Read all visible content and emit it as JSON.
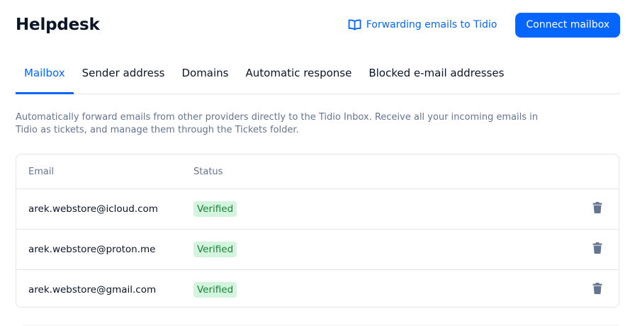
{
  "header": {
    "title": "Helpdesk",
    "doc_link_label": "Forwarding emails to Tidio",
    "doc_link_icon": "book-open-icon",
    "connect_button_label": "Connect mailbox"
  },
  "tabs": [
    {
      "label": "Mailbox",
      "active": true
    },
    {
      "label": "Sender address",
      "active": false
    },
    {
      "label": "Domains",
      "active": false
    },
    {
      "label": "Automatic response",
      "active": false
    },
    {
      "label": "Blocked e-mail addresses",
      "active": false
    }
  ],
  "description": "Automatically forward emails from other providers directly to the Tidio Inbox. Receive all your incoming emails in Tidio as tickets, and manage them through the Tickets folder.",
  "table": {
    "columns": {
      "email": "Email",
      "status": "Status"
    },
    "rows": [
      {
        "email": "arek.webstore@icloud.com",
        "status": "Verified",
        "action_icon": "trash-icon"
      },
      {
        "email": "arek.webstore@proton.me",
        "status": "Verified",
        "action_icon": "trash-icon"
      },
      {
        "email": "arek.webstore@gmail.com",
        "status": "Verified",
        "action_icon": "trash-icon"
      }
    ]
  },
  "colors": {
    "accent": "#0566ff",
    "verified_bg": "#d4f5dd",
    "verified_text": "#1a7f3a",
    "muted_text": "#647491",
    "icon_gray": "#647491"
  }
}
